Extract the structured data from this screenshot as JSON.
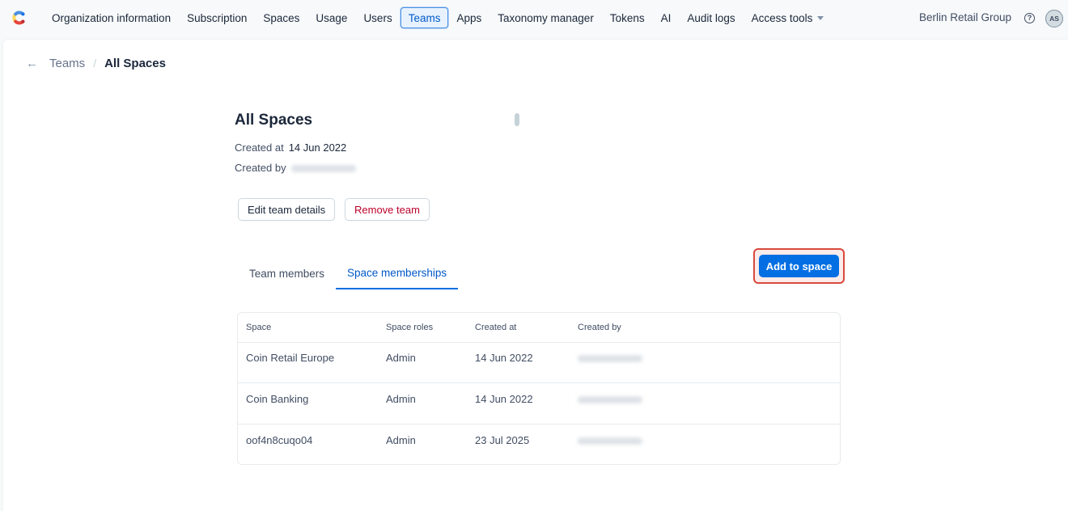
{
  "nav": {
    "items": [
      {
        "label": "Organization information",
        "active": false
      },
      {
        "label": "Subscription",
        "active": false
      },
      {
        "label": "Spaces",
        "active": false
      },
      {
        "label": "Usage",
        "active": false
      },
      {
        "label": "Users",
        "active": false
      },
      {
        "label": "Teams",
        "active": true
      },
      {
        "label": "Apps",
        "active": false
      },
      {
        "label": "Taxonomy manager",
        "active": false
      },
      {
        "label": "Tokens",
        "active": false
      },
      {
        "label": "AI",
        "active": false
      },
      {
        "label": "Audit logs",
        "active": false
      }
    ],
    "access_tools_label": "Access tools",
    "org_name": "Berlin Retail Group",
    "help_glyph": "?",
    "avatar_initials": "AS"
  },
  "breadcrumb": {
    "back_icon": "arrow-left-icon",
    "parent": "Teams",
    "separator": "/",
    "current": "All Spaces"
  },
  "team": {
    "title": "All Spaces",
    "created_at_label": "Created at",
    "created_at": "14 Jun 2022",
    "created_by_label": "Created by"
  },
  "actions": {
    "edit_label": "Edit team details",
    "remove_label": "Remove team",
    "add_label": "Add to space"
  },
  "tabs": [
    {
      "label": "Team members",
      "active": false
    },
    {
      "label": "Space memberships",
      "active": true
    }
  ],
  "table": {
    "headers": [
      "Space",
      "Space roles",
      "Created at",
      "Created by"
    ],
    "rows": [
      {
        "space": "Coin Retail Europe",
        "role": "Admin",
        "created_at": "14 Jun 2022"
      },
      {
        "space": "Coin Banking",
        "role": "Admin",
        "created_at": "14 Jun 2022"
      },
      {
        "space": "oof4n8cuqo04",
        "role": "Admin",
        "created_at": "23 Jul 2025"
      }
    ]
  },
  "colors": {
    "primary": "#036fe3",
    "danger": "#bd002a",
    "highlight": "#d84a3c"
  }
}
